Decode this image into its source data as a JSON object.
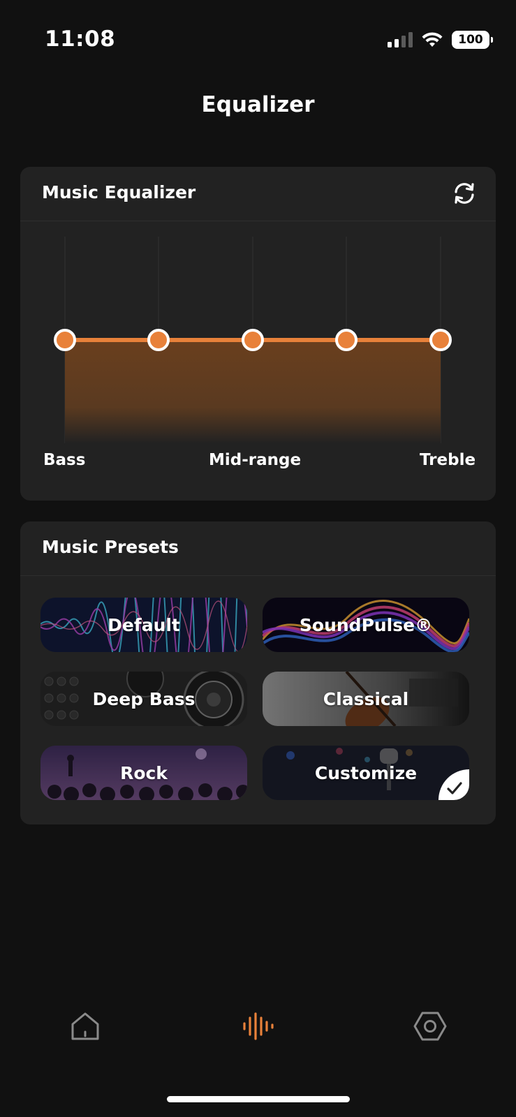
{
  "status": {
    "time": "11:08",
    "battery": "100"
  },
  "page": {
    "title": "Equalizer"
  },
  "equalizer": {
    "title": "Music Equalizer",
    "reset_icon": "refresh-icon",
    "labels": {
      "low": "Bass",
      "mid": "Mid-range",
      "high": "Treble"
    },
    "bands": [
      0,
      0,
      0,
      0,
      0
    ],
    "accent_color": "#e8813a"
  },
  "presets": {
    "title": "Music Presets",
    "items": [
      {
        "label": "Default"
      },
      {
        "label": "SoundPulse®"
      },
      {
        "label": "Deep Bass"
      },
      {
        "label": "Classical"
      },
      {
        "label": "Rock"
      },
      {
        "label": "Customize",
        "selected": true
      }
    ]
  },
  "tabs": [
    {
      "icon": "home-icon",
      "active": false
    },
    {
      "icon": "equalizer-waveform-icon",
      "active": true
    },
    {
      "icon": "settings-hexagon-icon",
      "active": false
    }
  ]
}
